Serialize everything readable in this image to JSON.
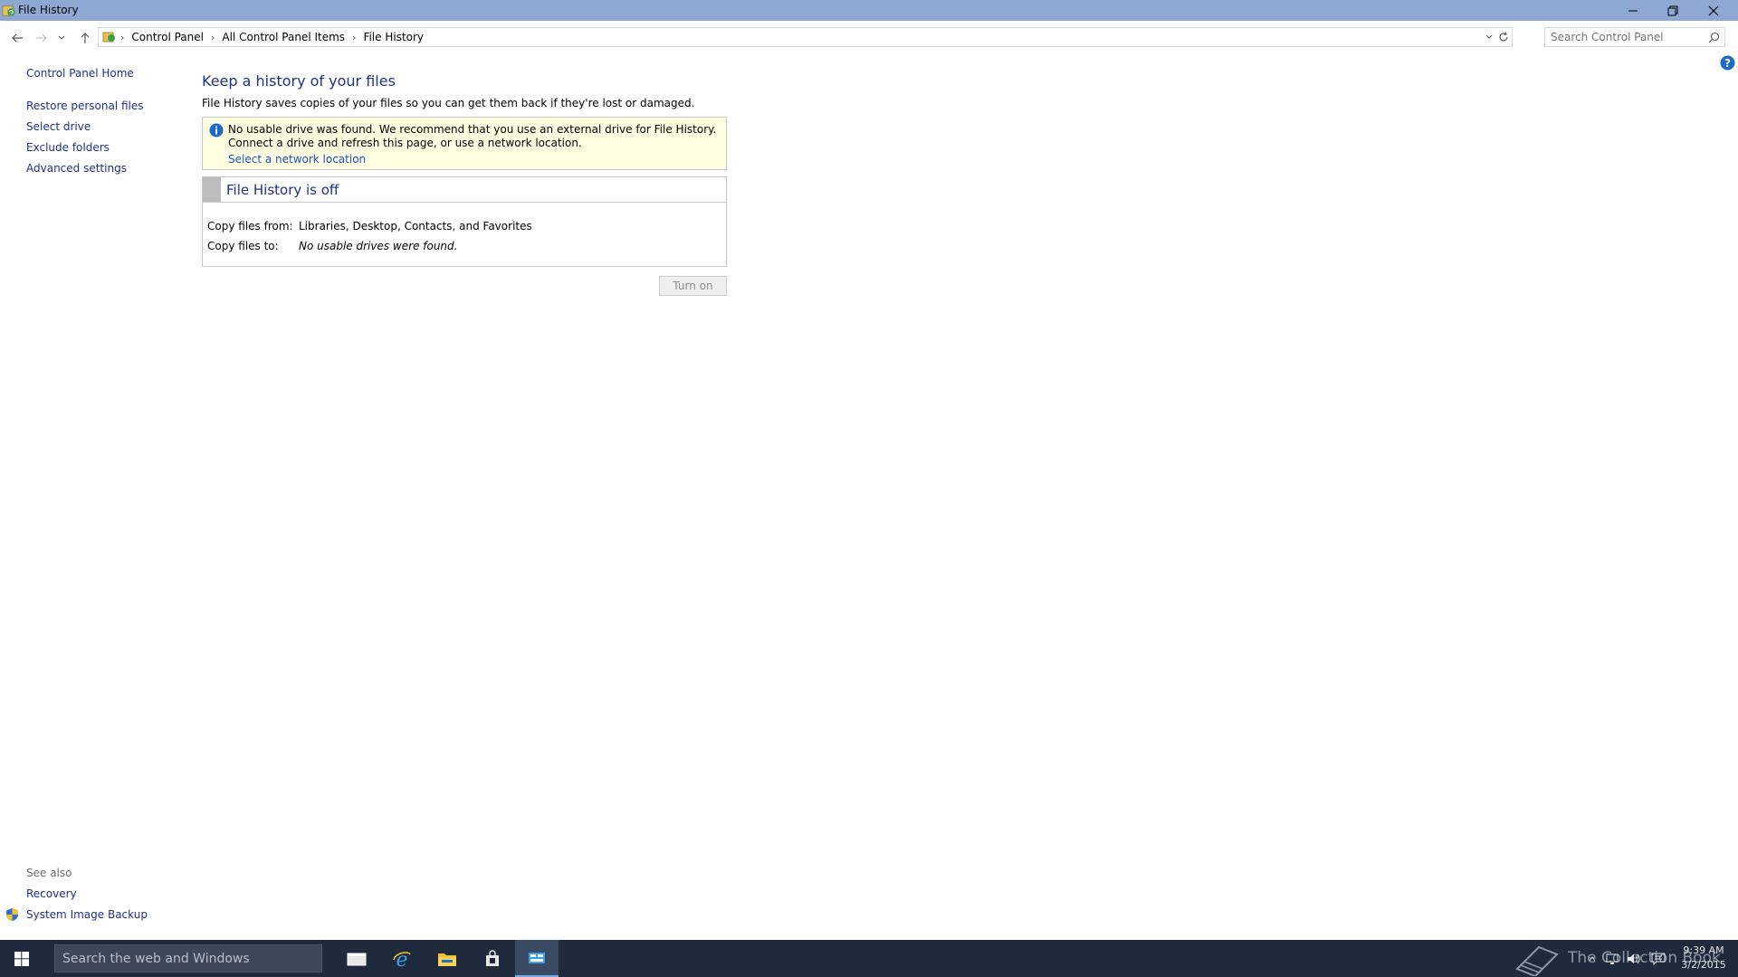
{
  "window": {
    "title": "File History",
    "colors": {
      "titlebar": "#8ea8d4",
      "link": "#1e3287",
      "infobox_bg": "#ffffe1",
      "taskbar": "#1f2a3c"
    }
  },
  "address": {
    "crumbs": [
      "Control Panel",
      "All Control Panel Items",
      "File History"
    ],
    "search_placeholder": "Search Control Panel"
  },
  "sidebar": {
    "home": "Control Panel Home",
    "links": [
      "Restore personal files",
      "Select drive",
      "Exclude folders",
      "Advanced settings"
    ],
    "see_also_label": "See also",
    "see_also": [
      "Recovery",
      "System Image Backup"
    ]
  },
  "main": {
    "heading": "Keep a history of your files",
    "description": "File History saves copies of your files so you can get them back if they're lost or damaged.",
    "info_message": "No usable drive was found. We recommend that you use an external drive for File History. Connect a drive and refresh this page, or use a network location.",
    "info_link": "Select a network location",
    "status_title": "File History is off",
    "copy_from_label": "Copy files from:",
    "copy_from_value": "Libraries, Desktop, Contacts, and Favorites",
    "copy_to_label": "Copy files to:",
    "copy_to_value": "No usable drives were found.",
    "turn_on_label": "Turn on"
  },
  "taskbar": {
    "search_placeholder": "Search the web and Windows",
    "watermark": "The Collection Book",
    "time": "9:39 AM",
    "date": "3/2/2015",
    "icons": [
      "task-view-icon",
      "internet-explorer-icon",
      "file-explorer-icon",
      "store-icon",
      "control-panel-icon"
    ]
  }
}
